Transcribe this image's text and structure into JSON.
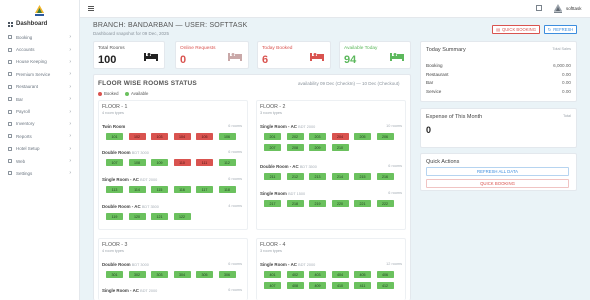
{
  "sidebar": {
    "brand": "Dashboard",
    "items": [
      {
        "label": "Booking",
        "icon": "booking-icon"
      },
      {
        "label": "Accounts",
        "icon": "accounts-icon"
      },
      {
        "label": "House Keeping",
        "icon": "housekeeping-icon"
      },
      {
        "label": "Premium Service",
        "icon": "premium-icon"
      },
      {
        "label": "Restaurant",
        "icon": "restaurant-icon"
      },
      {
        "label": "Bar",
        "icon": "bar-icon"
      },
      {
        "label": "Payroll",
        "icon": "payroll-icon"
      },
      {
        "label": "Inventory",
        "icon": "inventory-icon"
      },
      {
        "label": "Reports",
        "icon": "reports-icon"
      },
      {
        "label": "Hotel Setup",
        "icon": "hotel-setup-icon"
      },
      {
        "label": "Web",
        "icon": "web-icon"
      },
      {
        "label": "Settings",
        "icon": "settings-icon"
      }
    ]
  },
  "topbar": {
    "username": "softtask"
  },
  "header": {
    "title": "BRANCH: BANDARBAN — USER: SOFTTASK",
    "subtitle": "Dashboard snapshot for 09 Dec, 2025",
    "quick_booking": "QUICK BOOKING",
    "refresh": "REFRESH"
  },
  "stats": [
    {
      "label": "Total Rooms",
      "value": "100",
      "color": "#222222"
    },
    {
      "label": "Online Requests",
      "value": "0",
      "color": "#d9534f"
    },
    {
      "label": "Today Booked",
      "value": "6",
      "color": "#d9534f"
    },
    {
      "label": "Available Today",
      "value": "94",
      "color": "#5cb85c"
    }
  ],
  "rooms_status": {
    "title": "FLOOR WISE ROOMS STATUS",
    "availability": "availability 09 Dec (CheckIn) — 10 Dec (Checkout)",
    "legend": {
      "booked": "Booked",
      "available": "Available"
    },
    "colors": {
      "booked": "#d9534f",
      "available": "#6bc15e"
    }
  },
  "floors": [
    {
      "title": "FLOOR - 1",
      "sub": "4 room types",
      "types": [
        {
          "name": "Twin Room",
          "price": "",
          "count": "6 rooms",
          "rooms": [
            {
              "n": "101",
              "b": false
            },
            {
              "n": "102",
              "b": true
            },
            {
              "n": "103",
              "b": true
            },
            {
              "n": "104",
              "b": true
            },
            {
              "n": "105",
              "b": true
            },
            {
              "n": "106",
              "b": false
            }
          ]
        },
        {
          "name": "Double Room",
          "price": "BDT 3000",
          "count": "6 rooms",
          "rooms": [
            {
              "n": "107",
              "b": false
            },
            {
              "n": "108",
              "b": false
            },
            {
              "n": "109",
              "b": false
            },
            {
              "n": "110",
              "b": true
            },
            {
              "n": "111",
              "b": true
            },
            {
              "n": "112",
              "b": false
            }
          ]
        },
        {
          "name": "Single Room - AC",
          "price": "BDT 2000",
          "count": "6 rooms",
          "rooms": [
            {
              "n": "113",
              "b": false
            },
            {
              "n": "114",
              "b": false
            },
            {
              "n": "115",
              "b": false
            },
            {
              "n": "116",
              "b": false
            },
            {
              "n": "117",
              "b": false
            },
            {
              "n": "118",
              "b": false
            }
          ]
        },
        {
          "name": "Double Room - AC",
          "price": "BDT 3500",
          "count": "4 rooms",
          "rooms": [
            {
              "n": "119",
              "b": false
            },
            {
              "n": "120",
              "b": false
            },
            {
              "n": "121",
              "b": false
            },
            {
              "n": "122",
              "b": false
            }
          ]
        }
      ]
    },
    {
      "title": "FLOOR - 2",
      "sub": "3 room types",
      "types": [
        {
          "name": "Single Room - AC",
          "price": "BDT 2000",
          "count": "10 rooms",
          "rooms": [
            {
              "n": "201",
              "b": false
            },
            {
              "n": "202",
              "b": false
            },
            {
              "n": "203",
              "b": false
            },
            {
              "n": "204",
              "b": true
            },
            {
              "n": "205",
              "b": false
            },
            {
              "n": "206",
              "b": false
            },
            {
              "n": "207",
              "b": false
            },
            {
              "n": "208",
              "b": false
            },
            {
              "n": "209",
              "b": false
            },
            {
              "n": "210",
              "b": false
            }
          ]
        },
        {
          "name": "Double Room - AC",
          "price": "BDT 3500",
          "count": "6 rooms",
          "rooms": [
            {
              "n": "211",
              "b": false
            },
            {
              "n": "212",
              "b": false
            },
            {
              "n": "213",
              "b": false
            },
            {
              "n": "214",
              "b": false
            },
            {
              "n": "215",
              "b": false
            },
            {
              "n": "216",
              "b": false
            }
          ]
        },
        {
          "name": "Single Room",
          "price": "BDT 1500",
          "count": "6 rooms",
          "rooms": [
            {
              "n": "217",
              "b": false
            },
            {
              "n": "218",
              "b": false
            },
            {
              "n": "219",
              "b": false
            },
            {
              "n": "220",
              "b": false
            },
            {
              "n": "221",
              "b": false
            },
            {
              "n": "222",
              "b": false
            }
          ]
        }
      ]
    },
    {
      "title": "FLOOR - 3",
      "sub": "4 room types",
      "types": [
        {
          "name": "Double Room",
          "price": "BDT 3000",
          "count": "6 rooms",
          "rooms": [
            {
              "n": "301",
              "b": false
            },
            {
              "n": "302",
              "b": false
            },
            {
              "n": "303",
              "b": false
            },
            {
              "n": "304",
              "b": false
            },
            {
              "n": "305",
              "b": false
            },
            {
              "n": "306",
              "b": false
            }
          ]
        },
        {
          "name": "Single Room - AC",
          "price": "BDT 2000",
          "count": "6 rooms",
          "rooms": []
        }
      ]
    },
    {
      "title": "FLOOR - 4",
      "sub": "3 room types",
      "types": [
        {
          "name": "Single Room - AC",
          "price": "BDT 2000",
          "count": "12 rooms",
          "rooms": [
            {
              "n": "401",
              "b": false
            },
            {
              "n": "402",
              "b": false
            },
            {
              "n": "403",
              "b": false
            },
            {
              "n": "404",
              "b": false
            },
            {
              "n": "405",
              "b": false
            },
            {
              "n": "406",
              "b": false
            },
            {
              "n": "407",
              "b": false
            },
            {
              "n": "408",
              "b": false
            },
            {
              "n": "409",
              "b": false
            },
            {
              "n": "410",
              "b": false
            },
            {
              "n": "411",
              "b": false
            },
            {
              "n": "412",
              "b": false
            }
          ]
        }
      ]
    }
  ],
  "summary": {
    "title": "Today Summary",
    "tag": "Total Sales",
    "rows": [
      {
        "label": "Booking",
        "value": "6,000.00"
      },
      {
        "label": "Restaurant",
        "value": "0.00"
      },
      {
        "label": "Bar",
        "value": "0.00"
      },
      {
        "label": "Service",
        "value": "0.00"
      }
    ]
  },
  "expense": {
    "title": "Expense of This Month",
    "tag": "Total",
    "value": "0"
  },
  "quick_actions": {
    "title": "Quick Actions",
    "refresh_all": "REFRESH ALL DATA",
    "quick_booking": "QUICK BOOKING"
  }
}
